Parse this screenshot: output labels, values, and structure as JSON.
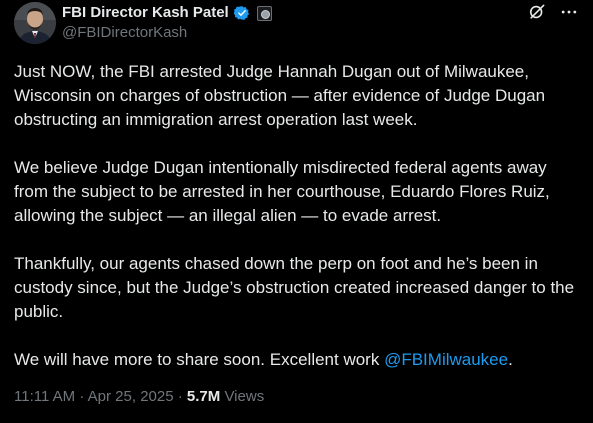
{
  "author": {
    "display_name": "FBI Director Kash Patel",
    "handle": "@FBIDirectorKash",
    "verified_color": "#1d9bf0",
    "affiliation_badge_icon": "fbi-seal-icon"
  },
  "header_icons": [
    "grok-icon",
    "more-icon"
  ],
  "tweet": {
    "paragraphs": [
      "Just NOW, the FBI arrested Judge Hannah Dugan out of Milwaukee, Wisconsin on charges of obstruction — after evidence of Judge Dugan obstructing an immigration arrest operation last week.",
      "We believe Judge Dugan intentionally misdirected federal agents away from the subject to be arrested in her courthouse, Eduardo Flores Ruiz, allowing the subject — an illegal alien — to evade arrest.",
      "Thankfully, our agents chased down the perp on foot and he’s been in custody since, but the Judge’s obstruction created increased danger to the public."
    ],
    "last_paragraph": {
      "text_before": "We will have more to share soon. Excellent work ",
      "mention": "@FBIMilwaukee",
      "text_after": "."
    }
  },
  "meta": {
    "time": "11:11 AM",
    "separator": "·",
    "date": "Apr 25, 2025",
    "views_count": "5.7M",
    "views_label": "Views"
  },
  "colors": {
    "background": "#000000",
    "text": "#e7e9ea",
    "secondary_text": "#71767b",
    "link": "#1d9bf0"
  }
}
